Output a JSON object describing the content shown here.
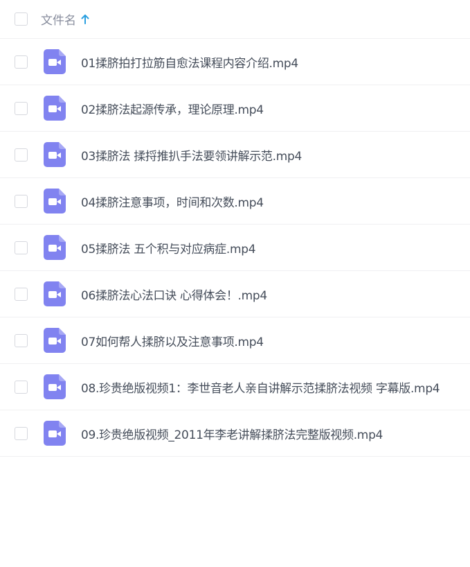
{
  "header": {
    "column_label": "文件名",
    "sort_direction": "ascending",
    "sort_icon": "arrow-up-icon",
    "accent_color": "#2a9fe0"
  },
  "file_icon": {
    "name": "video-file-icon",
    "color": "#8183f0"
  },
  "files": [
    {
      "name": "01揉脐拍打拉筋自愈法课程内容介绍.mp4"
    },
    {
      "name": "02揉脐法起源传承，理论原理.mp4"
    },
    {
      "name": "03揉脐法 揉捋推扒手法要领讲解示范.mp4"
    },
    {
      "name": "04揉脐注意事项，时间和次数.mp4"
    },
    {
      "name": "05揉脐法 五个积与对应病症.mp4"
    },
    {
      "name": "06揉脐法心法口诀 心得体会！.mp4"
    },
    {
      "name": "07如何帮人揉脐以及注意事项.mp4"
    },
    {
      "name": "08.珍贵绝版视频1：李世音老人亲自讲解示范揉脐法视频 字幕版.mp4"
    },
    {
      "name": "09.珍贵绝版视频_2011年李老讲解揉脐法完整版视频.mp4"
    }
  ]
}
